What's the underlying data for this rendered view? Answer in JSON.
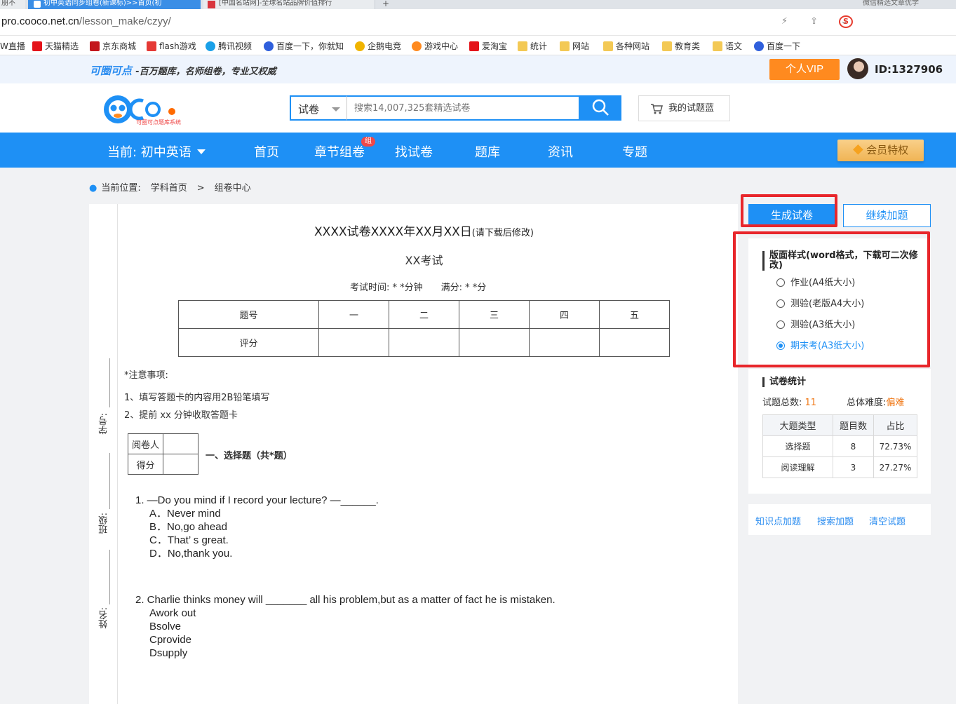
{
  "browser": {
    "tabs": [
      {
        "label": "朋不"
      },
      {
        "label": "初中英语同步组卷(新课标)>>首页(初"
      },
      {
        "label": "[中国名站网]-全球名站品牌价值排行"
      },
      {
        "label": "微信精选文章优学"
      }
    ],
    "new_tab": "+",
    "url_host": "pro.cooco.net.cn",
    "url_path": "/lesson_make/czyy/",
    "right_icons": "⚡ ⇪ ⌄",
    "sogou": "S",
    "bookmarks": [
      {
        "label": "W直播",
        "color": "#ffffff"
      },
      {
        "label": "天猫精选",
        "color": "#e4131a"
      },
      {
        "label": "京东商城",
        "color": "#c3161c"
      },
      {
        "label": "flash游戏",
        "color": "#e53935"
      },
      {
        "label": "腾讯视频",
        "color": "#1aa0e8"
      },
      {
        "label": "百度一下，你就知",
        "color": "#2f5fdc"
      },
      {
        "label": "企鹅电竞",
        "color": "#f0b400"
      },
      {
        "label": "游戏中心",
        "color": "#ff8a1f"
      },
      {
        "label": "爱淘宝",
        "color": "#e4131a"
      },
      {
        "label": "统计",
        "color": "#f3c955"
      },
      {
        "label": "网站",
        "color": "#f3c955"
      },
      {
        "label": "各种网站",
        "color": "#f3c955"
      },
      {
        "label": "教育类",
        "color": "#f3c955"
      },
      {
        "label": "语文",
        "color": "#f3c955"
      },
      {
        "label": "百度一下",
        "color": "#2f5fdc"
      }
    ]
  },
  "site": {
    "brand": "可圈可点",
    "slogan": "-百万题库，名师组卷，专业又权威",
    "vip_label": "个人VIP",
    "user_id": "ID:1327906",
    "logo_caption": "可圈可点题库系统"
  },
  "search": {
    "type": "试卷",
    "placeholder": "搜索14,007,325套精选试卷",
    "basket_label": "我的试题蓝"
  },
  "nav": {
    "current": "当前: 初中英语",
    "items": [
      "首页",
      "章节组卷",
      "找试卷",
      "题库",
      "资讯",
      "专题"
    ],
    "badge": "组",
    "member": "会员特权"
  },
  "breadcrumb": {
    "label": "当前位置:",
    "items": [
      "学科首页",
      ">",
      "组卷中心"
    ]
  },
  "paper": {
    "title": "XXXX试卷XXXX年XX月XX日",
    "title_note": "(请下载后修改)",
    "subtitle": "XX考试",
    "time_line": "考试时间: * *分钟　　满分: * *分",
    "binding": {
      "xuehao": "学号:",
      "banji": "班级:",
      "xingming": "姓名:"
    },
    "score_table": {
      "header": [
        "题号",
        "一",
        "二",
        "三",
        "四",
        "五"
      ],
      "row": [
        "评分",
        "",
        "",
        "",
        "",
        ""
      ]
    },
    "notes_title": "*注意事项:",
    "notes": [
      "1、填写答题卡的内容用2B铅笔填写",
      "2、提前 xx 分钟收取答题卡"
    ],
    "grader": {
      "reader": "阅卷人",
      "score": "得分"
    },
    "section_title": "一、选择题（共*题）",
    "questions": [
      {
        "stem": "1.  —Do you mind if I record your lecture?  —______.",
        "options": [
          "A．Never mind",
          "B．No,go ahead",
          "C．That’ s great.",
          "D．No,thank you."
        ]
      },
      {
        "stem": "2.  Charlie thinks money will _______ all his problem,but as a matter of fact he is mistaken.",
        "options": [
          "Awork out",
          "Bsolve",
          "Cprovide",
          "Dsupply"
        ]
      }
    ]
  },
  "panel": {
    "generate": "生成试卷",
    "continue": "继续加题",
    "layout_title": "版面样式(word格式，下载可二次修改)",
    "layout_options": [
      {
        "label": "作业(A4纸大小)",
        "selected": false
      },
      {
        "label": "测验(老版A4大小)",
        "selected": false
      },
      {
        "label": "测验(A3纸大小)",
        "selected": false
      },
      {
        "label": "期末考(A3纸大小)",
        "selected": true
      }
    ],
    "stats_title": "试卷统计",
    "total_label": "试题总数:",
    "total": "11",
    "difficulty_label": "总体难度:",
    "difficulty": "偏难",
    "stats_table": {
      "header": [
        "大题类型",
        "题目数",
        "占比"
      ],
      "rows": [
        [
          "选择题",
          "8",
          "72.73%"
        ],
        [
          "阅读理解",
          "3",
          "27.27%"
        ]
      ]
    },
    "links": [
      "知识点加题",
      "搜索加题",
      "清空试题"
    ]
  }
}
